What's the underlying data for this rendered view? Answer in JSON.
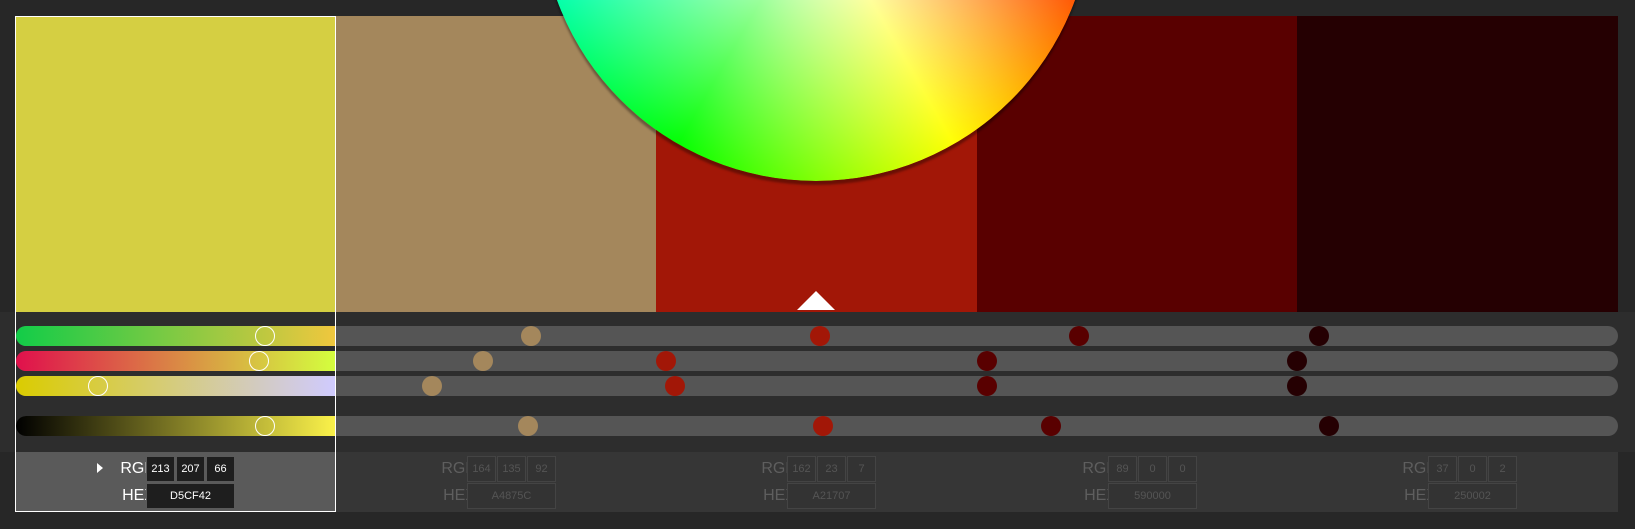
{
  "selected_index": 0,
  "swatches": [
    {
      "color": "#D5CF42",
      "rgb": [
        "213",
        "207",
        "66"
      ],
      "hex": "D5CF42"
    },
    {
      "color": "#A4875C",
      "rgb": [
        "164",
        "135",
        "92"
      ],
      "hex": "A4875C"
    },
    {
      "color": "#A21707",
      "rgb": [
        "162",
        "23",
        "7"
      ],
      "hex": "A21707"
    },
    {
      "color": "#590000",
      "rgb": [
        "89",
        "0",
        "0"
      ],
      "hex": "590000"
    },
    {
      "color": "#250002",
      "rgb": [
        "37",
        "0",
        "2"
      ],
      "hex": "250002"
    }
  ],
  "labels": {
    "rgb": "RGB",
    "hex": "HEX"
  },
  "sliders": [
    {
      "name": "slider-1",
      "levels": [
        0.78,
        0.61,
        0.51,
        0.32,
        0.07
      ]
    },
    {
      "name": "slider-2",
      "levels": [
        0.76,
        0.46,
        0.03,
        0.03,
        0.0
      ]
    },
    {
      "name": "slider-3",
      "levels": [
        0.26,
        0.3,
        0.06,
        0.03,
        0.0
      ]
    },
    {
      "name": "brightness",
      "levels": [
        0.78,
        0.6,
        0.52,
        0.23,
        0.1
      ]
    }
  ]
}
